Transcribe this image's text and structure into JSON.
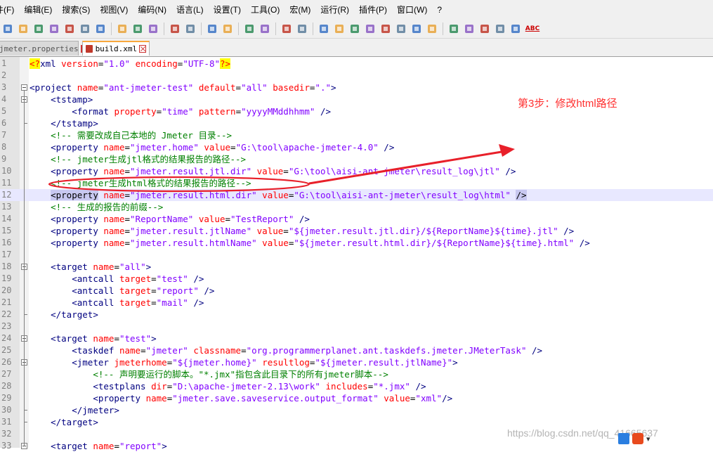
{
  "menu": [
    "件(F)",
    "编辑(E)",
    "搜索(S)",
    "视图(V)",
    "编码(N)",
    "语言(L)",
    "设置(T)",
    "工具(O)",
    "宏(M)",
    "运行(R)",
    "插件(P)",
    "窗口(W)",
    "?"
  ],
  "toolbar_icons": [
    "new-file-icon",
    "open-file-icon",
    "save-icon",
    "save-all-icon",
    "close-icon",
    "close-all-icon",
    "print-icon",
    "cut-icon",
    "copy-icon",
    "paste-icon",
    "undo-icon",
    "redo-icon",
    "find-icon",
    "replace-icon",
    "zoom-in-icon",
    "zoom-out-icon",
    "sync-v-icon",
    "sync-h-icon",
    "word-wrap-icon",
    "all-chars-icon",
    "indent-guide-icon",
    "udl-icon",
    "doc-map-icon",
    "function-list-icon",
    "folder-workspace-icon",
    "monitor-icon",
    "record-macro-icon",
    "stop-record-icon",
    "play-macro-icon",
    "run-macro-multiple-icon",
    "save-macro-icon",
    "spellcheck-icon"
  ],
  "spellcheck_label": "ABC",
  "tabs": {
    "inactive": "jmeter.properties",
    "active": "build.xml"
  },
  "lines": [
    {
      "n": "1",
      "parts": [
        [
          "pi",
          "<?"
        ],
        [
          "k",
          "xml "
        ],
        [
          "a",
          "version"
        ],
        [
          "t",
          "="
        ],
        [
          "v",
          "\"1.0\""
        ],
        [
          "t",
          " "
        ],
        [
          "a",
          "encoding"
        ],
        [
          "t",
          "="
        ],
        [
          "v",
          "\"UTF-8\""
        ],
        [
          "pi",
          "?>"
        ]
      ]
    },
    {
      "n": "2",
      "parts": []
    },
    {
      "n": "3",
      "parts": [
        [
          "k",
          "<project "
        ],
        [
          "a",
          "name"
        ],
        [
          "t",
          "="
        ],
        [
          "v",
          "\"ant-jmeter-test\""
        ],
        [
          "t",
          " "
        ],
        [
          "a",
          "default"
        ],
        [
          "t",
          "="
        ],
        [
          "v",
          "\"all\""
        ],
        [
          "t",
          " "
        ],
        [
          "a",
          "basedir"
        ],
        [
          "t",
          "="
        ],
        [
          "v",
          "\".\""
        ],
        [
          "k",
          ">"
        ]
      ]
    },
    {
      "n": "4",
      "parts": [
        [
          "t",
          "    "
        ],
        [
          "k",
          "<tstamp>"
        ]
      ]
    },
    {
      "n": "5",
      "parts": [
        [
          "t",
          "        "
        ],
        [
          "k",
          "<format "
        ],
        [
          "a",
          "property"
        ],
        [
          "t",
          "="
        ],
        [
          "v",
          "\"time\""
        ],
        [
          "t",
          " "
        ],
        [
          "a",
          "pattern"
        ],
        [
          "t",
          "="
        ],
        [
          "v",
          "\"yyyyMMddhhmm\""
        ],
        [
          "t",
          " "
        ],
        [
          "k",
          "/>"
        ]
      ]
    },
    {
      "n": "6",
      "parts": [
        [
          "t",
          "    "
        ],
        [
          "k",
          "</tstamp>"
        ]
      ]
    },
    {
      "n": "7",
      "parts": [
        [
          "t",
          "    "
        ],
        [
          "c",
          "<!-- 需要改成自己本地的 Jmeter 目录-->"
        ]
      ]
    },
    {
      "n": "8",
      "parts": [
        [
          "t",
          "    "
        ],
        [
          "k",
          "<property "
        ],
        [
          "a",
          "name"
        ],
        [
          "t",
          "="
        ],
        [
          "v",
          "\"jmeter.home\""
        ],
        [
          "t",
          " "
        ],
        [
          "a",
          "value"
        ],
        [
          "t",
          "="
        ],
        [
          "v",
          "\"G:\\tool\\apache-jmeter-4.0\""
        ],
        [
          "t",
          " "
        ],
        [
          "k",
          "/>"
        ]
      ]
    },
    {
      "n": "9",
      "parts": [
        [
          "t",
          "    "
        ],
        [
          "c",
          "<!-- jmeter生成jtl格式的结果报告的路径-->"
        ]
      ]
    },
    {
      "n": "10",
      "parts": [
        [
          "t",
          "    "
        ],
        [
          "k",
          "<property "
        ],
        [
          "a",
          "name"
        ],
        [
          "t",
          "="
        ],
        [
          "v",
          "\"jmeter.result.jtl.dir\""
        ],
        [
          "t",
          " "
        ],
        [
          "a",
          "value"
        ],
        [
          "t",
          "="
        ],
        [
          "v",
          "\"G:\\tool\\aisi-ant-jmeter\\result_log\\jtl\""
        ],
        [
          "t",
          " "
        ],
        [
          "k",
          "/>"
        ]
      ]
    },
    {
      "n": "11",
      "parts": [
        [
          "t",
          "    "
        ],
        [
          "c",
          "<!-- jmeter生成html格式的结果报告的路径-->"
        ]
      ]
    },
    {
      "n": "12",
      "parts": [
        [
          "t",
          "    "
        ],
        [
          "hl",
          "<property"
        ],
        [
          "t",
          " "
        ],
        [
          "a",
          "name"
        ],
        [
          "t",
          "="
        ],
        [
          "v",
          "\"jmeter.result.html.dir\""
        ],
        [
          "t",
          " "
        ],
        [
          "a",
          "value"
        ],
        [
          "t",
          "="
        ],
        [
          "v",
          "\"G:\\tool\\aisi-ant-jmeter\\result_log\\html\""
        ],
        [
          "t",
          " "
        ],
        [
          "hl",
          "/>"
        ]
      ]
    },
    {
      "n": "13",
      "parts": [
        [
          "t",
          "    "
        ],
        [
          "c",
          "<!-- 生成的报告的前缀-->"
        ]
      ]
    },
    {
      "n": "14",
      "parts": [
        [
          "t",
          "    "
        ],
        [
          "k",
          "<property "
        ],
        [
          "a",
          "name"
        ],
        [
          "t",
          "="
        ],
        [
          "v",
          "\"ReportName\""
        ],
        [
          "t",
          " "
        ],
        [
          "a",
          "value"
        ],
        [
          "t",
          "="
        ],
        [
          "v",
          "\"TestReport\""
        ],
        [
          "t",
          " "
        ],
        [
          "k",
          "/>"
        ]
      ]
    },
    {
      "n": "15",
      "parts": [
        [
          "t",
          "    "
        ],
        [
          "k",
          "<property "
        ],
        [
          "a",
          "name"
        ],
        [
          "t",
          "="
        ],
        [
          "v",
          "\"jmeter.result.jtlName\""
        ],
        [
          "t",
          " "
        ],
        [
          "a",
          "value"
        ],
        [
          "t",
          "="
        ],
        [
          "v",
          "\"${jmeter.result.jtl.dir}/${ReportName}${time}.jtl\""
        ],
        [
          "t",
          " "
        ],
        [
          "k",
          "/>"
        ]
      ]
    },
    {
      "n": "16",
      "parts": [
        [
          "t",
          "    "
        ],
        [
          "k",
          "<property "
        ],
        [
          "a",
          "name"
        ],
        [
          "t",
          "="
        ],
        [
          "v",
          "\"jmeter.result.htmlName\""
        ],
        [
          "t",
          " "
        ],
        [
          "a",
          "value"
        ],
        [
          "t",
          "="
        ],
        [
          "v",
          "\"${jmeter.result.html.dir}/${ReportName}${time}.html\""
        ],
        [
          "t",
          " "
        ],
        [
          "k",
          "/>"
        ]
      ]
    },
    {
      "n": "17",
      "parts": []
    },
    {
      "n": "18",
      "parts": [
        [
          "t",
          "    "
        ],
        [
          "k",
          "<target "
        ],
        [
          "a",
          "name"
        ],
        [
          "t",
          "="
        ],
        [
          "v",
          "\"all\""
        ],
        [
          "k",
          ">"
        ]
      ]
    },
    {
      "n": "19",
      "parts": [
        [
          "t",
          "        "
        ],
        [
          "k",
          "<antcall "
        ],
        [
          "a",
          "target"
        ],
        [
          "t",
          "="
        ],
        [
          "v",
          "\"test\""
        ],
        [
          "t",
          " "
        ],
        [
          "k",
          "/>"
        ]
      ]
    },
    {
      "n": "20",
      "parts": [
        [
          "t",
          "        "
        ],
        [
          "k",
          "<antcall "
        ],
        [
          "a",
          "target"
        ],
        [
          "t",
          "="
        ],
        [
          "v",
          "\"report\""
        ],
        [
          "t",
          " "
        ],
        [
          "k",
          "/>"
        ]
      ]
    },
    {
      "n": "21",
      "parts": [
        [
          "t",
          "        "
        ],
        [
          "k",
          "<antcall "
        ],
        [
          "a",
          "target"
        ],
        [
          "t",
          "="
        ],
        [
          "v",
          "\"mail\""
        ],
        [
          "t",
          " "
        ],
        [
          "k",
          "/>"
        ]
      ]
    },
    {
      "n": "22",
      "parts": [
        [
          "t",
          "    "
        ],
        [
          "k",
          "</target>"
        ]
      ]
    },
    {
      "n": "23",
      "parts": []
    },
    {
      "n": "24",
      "parts": [
        [
          "t",
          "    "
        ],
        [
          "k",
          "<target "
        ],
        [
          "a",
          "name"
        ],
        [
          "t",
          "="
        ],
        [
          "v",
          "\"test\""
        ],
        [
          "k",
          ">"
        ]
      ]
    },
    {
      "n": "25",
      "parts": [
        [
          "t",
          "        "
        ],
        [
          "k",
          "<taskdef "
        ],
        [
          "a",
          "name"
        ],
        [
          "t",
          "="
        ],
        [
          "v",
          "\"jmeter\""
        ],
        [
          "t",
          " "
        ],
        [
          "a",
          "classname"
        ],
        [
          "t",
          "="
        ],
        [
          "v",
          "\"org.programmerplanet.ant.taskdefs.jmeter.JMeterTask\""
        ],
        [
          "t",
          " "
        ],
        [
          "k",
          "/>"
        ]
      ]
    },
    {
      "n": "26",
      "parts": [
        [
          "t",
          "        "
        ],
        [
          "k",
          "<jmeter "
        ],
        [
          "a",
          "jmeterhome"
        ],
        [
          "t",
          "="
        ],
        [
          "v",
          "\"${jmeter.home}\""
        ],
        [
          "t",
          " "
        ],
        [
          "a",
          "resultlog"
        ],
        [
          "t",
          "="
        ],
        [
          "v",
          "\"${jmeter.result.jtlName}\""
        ],
        [
          "k",
          ">"
        ]
      ]
    },
    {
      "n": "27",
      "parts": [
        [
          "t",
          "            "
        ],
        [
          "c",
          "<!-- 声明要运行的脚本。\"*.jmx\"指包含此目录下的所有jmeter脚本-->"
        ]
      ]
    },
    {
      "n": "28",
      "parts": [
        [
          "t",
          "            "
        ],
        [
          "k",
          "<testplans "
        ],
        [
          "a",
          "dir"
        ],
        [
          "t",
          "="
        ],
        [
          "v",
          "\"D:\\apache-jmeter-2.13\\work\""
        ],
        [
          "t",
          " "
        ],
        [
          "a",
          "includes"
        ],
        [
          "t",
          "="
        ],
        [
          "v",
          "\"*.jmx\""
        ],
        [
          "t",
          " "
        ],
        [
          "k",
          "/>"
        ]
      ]
    },
    {
      "n": "29",
      "parts": [
        [
          "t",
          "            "
        ],
        [
          "k",
          "<property "
        ],
        [
          "a",
          "name"
        ],
        [
          "t",
          "="
        ],
        [
          "v",
          "\"jmeter.save.saveservice.output_format\""
        ],
        [
          "t",
          " "
        ],
        [
          "a",
          "value"
        ],
        [
          "t",
          "="
        ],
        [
          "v",
          "\"xml\""
        ],
        [
          "k",
          "/>"
        ]
      ]
    },
    {
      "n": "30",
      "parts": [
        [
          "t",
          "        "
        ],
        [
          "k",
          "</jmeter>"
        ]
      ]
    },
    {
      "n": "31",
      "parts": [
        [
          "t",
          "    "
        ],
        [
          "k",
          "</target>"
        ]
      ]
    },
    {
      "n": "32",
      "parts": []
    },
    {
      "n": "33",
      "parts": [
        [
          "t",
          "    "
        ],
        [
          "k",
          "<target "
        ],
        [
          "a",
          "name"
        ],
        [
          "t",
          "="
        ],
        [
          "v",
          "\"report\""
        ],
        [
          "k",
          ">"
        ]
      ]
    }
  ],
  "current_line_index": 11,
  "annotation": "第3步：修改html路径",
  "watermark": "https://blog.csdn.net/qq_41665637",
  "colors": {
    "annotation": "#ff3030",
    "tag": "#000080",
    "attr": "#ff0000",
    "value": "#8000ff",
    "comment": "#008000"
  }
}
